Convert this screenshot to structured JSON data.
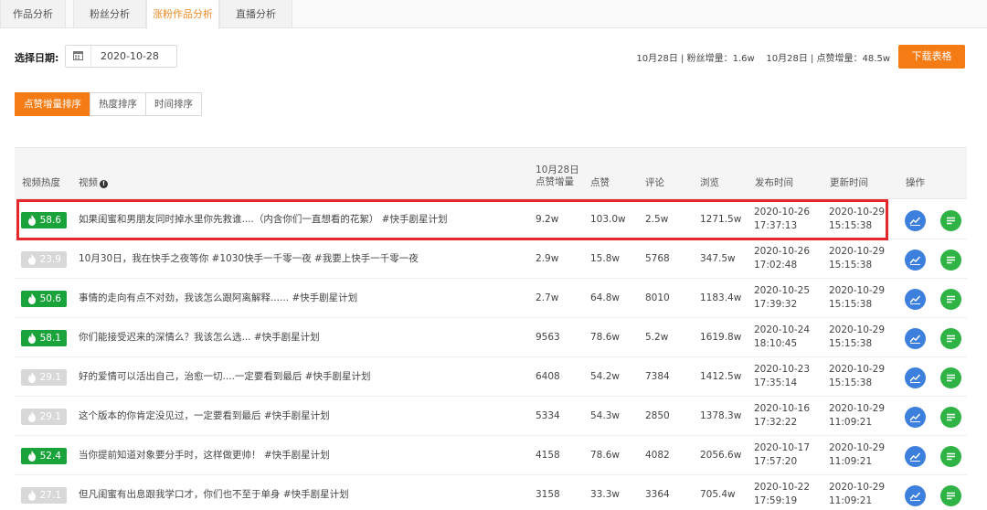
{
  "tabs": [
    "作品分析",
    "粉丝分析",
    "涨粉作品分析",
    "直播分析"
  ],
  "active_tab": 2,
  "filter": {
    "date_label": "选择日期:",
    "date_value": "2020-10-28",
    "summary": "10月28日 | 粉丝增量：1.6w    10月28日 | 点赞增量：48.5w",
    "download_label": "下载表格"
  },
  "sort": [
    "点赞增量排序",
    "热度排序",
    "时间排序"
  ],
  "table": {
    "headers": {
      "heat": "视频热度",
      "video": "视频",
      "inc_line1": "10月28日",
      "inc_line2": "点赞增量",
      "likes": "点赞",
      "comments": "评论",
      "views": "浏览",
      "publish": "发布时间",
      "update": "更新时间",
      "action": "操作"
    },
    "rows": [
      {
        "heat": "58.6",
        "hot": true,
        "title": "如果闺蜜和男朋友同时掉水里你先救谁....（内含你们一直想看的花絮） #快手剧星计划",
        "inc": "9.2w",
        "likes": "103.0w",
        "comments": "2.5w",
        "views": "1271.5w",
        "pub_date": "2020-10-26",
        "pub_time": "17:37:13",
        "upd_date": "2020-10-29",
        "upd_time": "15:15:38"
      },
      {
        "heat": "23.9",
        "hot": false,
        "title": "10月30日，我在快手之夜等你 #1030快手一千零一夜 #我要上快手一千零一夜",
        "inc": "2.9w",
        "likes": "15.8w",
        "comments": "5768",
        "views": "347.5w",
        "pub_date": "2020-10-26",
        "pub_time": "17:02:48",
        "upd_date": "2020-10-29",
        "upd_time": "15:15:38"
      },
      {
        "heat": "50.6",
        "hot": true,
        "title": "事情的走向有点不对劲，我该怎么跟阿离解释...... #快手剧星计划",
        "inc": "2.7w",
        "likes": "64.8w",
        "comments": "8010",
        "views": "1183.4w",
        "pub_date": "2020-10-25",
        "pub_time": "17:39:32",
        "upd_date": "2020-10-29",
        "upd_time": "15:15:38"
      },
      {
        "heat": "58.1",
        "hot": true,
        "title": "你们能接受迟来的深情么？我该怎么选... #快手剧星计划",
        "inc": "9563",
        "likes": "78.6w",
        "comments": "5.2w",
        "views": "1619.8w",
        "pub_date": "2020-10-24",
        "pub_time": "18:10:45",
        "upd_date": "2020-10-29",
        "upd_time": "15:15:38"
      },
      {
        "heat": "29.1",
        "hot": false,
        "title": "好的爱情可以活出自己，治愈一切....一定要看到最后 #快手剧星计划",
        "inc": "6408",
        "likes": "54.2w",
        "comments": "7384",
        "views": "1412.5w",
        "pub_date": "2020-10-23",
        "pub_time": "17:35:14",
        "upd_date": "2020-10-29",
        "upd_time": "15:15:38"
      },
      {
        "heat": "29.1",
        "hot": false,
        "title": "这个版本的你肯定没见过，一定要看到最后 #快手剧星计划",
        "inc": "5334",
        "likes": "54.3w",
        "comments": "2850",
        "views": "1378.3w",
        "pub_date": "2020-10-16",
        "pub_time": "17:32:22",
        "upd_date": "2020-10-29",
        "upd_time": "11:09:21"
      },
      {
        "heat": "52.4",
        "hot": true,
        "title": "当你提前知道对象要分手时，这样做更帅！ #快手剧星计划",
        "inc": "4158",
        "likes": "78.6w",
        "comments": "4082",
        "views": "2056.6w",
        "pub_date": "2020-10-17",
        "pub_time": "17:57:20",
        "upd_date": "2020-10-29",
        "upd_time": "11:09:21"
      },
      {
        "heat": "27.1",
        "hot": false,
        "title": "但凡闺蜜有出息跟我学口才，你们也不至于单身 #快手剧星计划",
        "inc": "3158",
        "likes": "33.3w",
        "comments": "3364",
        "views": "705.4w",
        "pub_date": "2020-10-22",
        "pub_time": "17:59:19",
        "upd_date": "2020-10-29",
        "upd_time": "11:09:21"
      }
    ]
  },
  "colors": {
    "accent": "#f57c14",
    "hot": "#1aa33b",
    "cold": "#d8d8d8",
    "chart_btn": "#3d7fdc",
    "list_btn": "#2fb344",
    "highlight": "#e5262b"
  }
}
